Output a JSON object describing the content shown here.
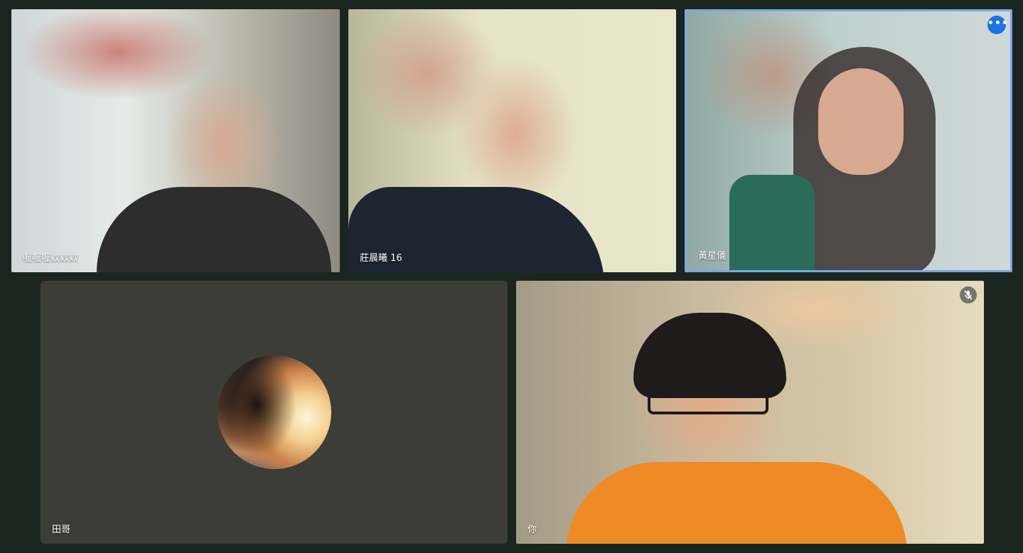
{
  "participants": [
    {
      "name": "喔喔喔欸欸欸",
      "muted": false,
      "has_video": true
    },
    {
      "name": "莊晨曦 16",
      "muted": false,
      "has_video": true
    },
    {
      "name": "黃星儀",
      "muted": false,
      "has_video": true,
      "active_speaker": true
    },
    {
      "name": "田哥",
      "muted": false,
      "has_video": false
    },
    {
      "name": "你",
      "muted": true,
      "has_video": true,
      "is_self": true
    }
  ],
  "colors": {
    "background": "#1b2520",
    "active_border": "#7aa6e8",
    "more_button": "#1a73e8",
    "avatar_tile": "#3c3d36"
  },
  "icons": {
    "more_options": "more-horizontal-icon",
    "mic_off": "mic-off-icon"
  },
  "more_button_glyph": "•••"
}
